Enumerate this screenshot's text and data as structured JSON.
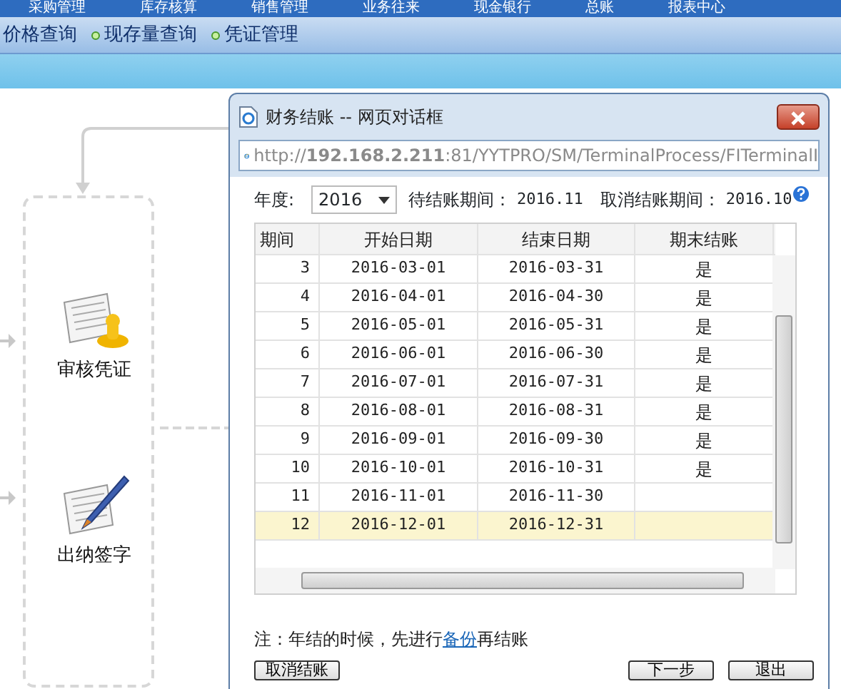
{
  "menu": [
    "采购管理",
    "库存核算",
    "销售管理",
    "业务往来",
    "现金银行",
    "总账",
    "报表中心"
  ],
  "sub_links": [
    "价格查询",
    "现存量查询",
    "凭证管理"
  ],
  "flow": {
    "nodes": [
      {
        "label": "审核凭证",
        "kind": "audit"
      },
      {
        "label": "出纳签字",
        "kind": "sign"
      }
    ]
  },
  "dialog": {
    "title": "财务结账 -- 网页对话框",
    "url": "http://**192.168.2.211**:81/YYTPRO/SM/TerminalProcess/FITerminalI",
    "year_label": "年度:",
    "year": "2016",
    "pending_label": "待结账期间：",
    "pending": "2016.11",
    "cancel_label": "取消结账期间：",
    "cancel": "2016.10",
    "table": {
      "columns": [
        "期间",
        "开始日期",
        "结束日期",
        "期末结账"
      ],
      "rows": [
        {
          "period": "3",
          "start": "2016-03-01",
          "end": "2016-03-31",
          "closed": "是",
          "selected": false
        },
        {
          "period": "4",
          "start": "2016-04-01",
          "end": "2016-04-30",
          "closed": "是",
          "selected": false
        },
        {
          "period": "5",
          "start": "2016-05-01",
          "end": "2016-05-31",
          "closed": "是",
          "selected": false
        },
        {
          "period": "6",
          "start": "2016-06-01",
          "end": "2016-06-30",
          "closed": "是",
          "selected": false
        },
        {
          "period": "7",
          "start": "2016-07-01",
          "end": "2016-07-31",
          "closed": "是",
          "selected": false
        },
        {
          "period": "8",
          "start": "2016-08-01",
          "end": "2016-08-31",
          "closed": "是",
          "selected": false
        },
        {
          "period": "9",
          "start": "2016-09-01",
          "end": "2016-09-30",
          "closed": "是",
          "selected": false
        },
        {
          "period": "10",
          "start": "2016-10-01",
          "end": "2016-10-31",
          "closed": "是",
          "selected": false
        },
        {
          "period": "11",
          "start": "2016-11-01",
          "end": "2016-11-30",
          "selected": false
        },
        {
          "period": "12",
          "start": "2016-12-01",
          "end": "2016-12-31",
          "selected": true
        }
      ]
    },
    "note": {
      "before": "注：年结的时候，先进行",
      "link": "备份",
      "after": "再结账"
    },
    "buttons": [
      {
        "label": "取消结账",
        "kind": "left"
      },
      {
        "label": "下一步",
        "kind": "right"
      },
      {
        "label": "退出",
        "kind": "right"
      }
    ]
  }
}
